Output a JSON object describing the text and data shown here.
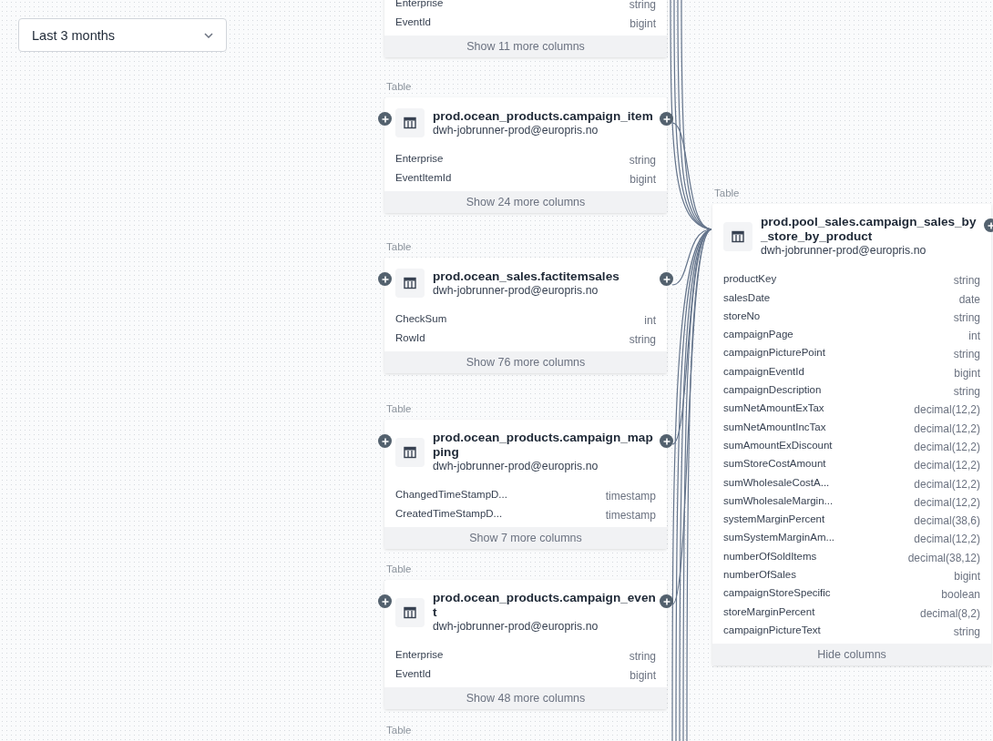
{
  "date_filter": {
    "value": "Last 3 months"
  },
  "upstream_nodes": [
    {
      "columns": [
        {
          "name": "Enterprise",
          "type": "string"
        },
        {
          "name": "EventId",
          "type": "bigint"
        }
      ],
      "toggle": "Show 11 more columns"
    },
    {
      "type_label": "Table",
      "title": "prod.ocean_products.campaign_item",
      "owner": "dwh-jobrunner-prod@europris.no",
      "upstream_button": true,
      "downstream_button": true,
      "columns": [
        {
          "name": "Enterprise",
          "type": "string"
        },
        {
          "name": "EventItemId",
          "type": "bigint"
        }
      ],
      "toggle": "Show 24 more columns"
    },
    {
      "type_label": "Table",
      "title": "prod.ocean_sales.factitemsales",
      "owner": "dwh-jobrunner-prod@europris.no",
      "upstream_button": true,
      "downstream_button": true,
      "columns": [
        {
          "name": "CheckSum",
          "type": "int"
        },
        {
          "name": "RowId",
          "type": "string"
        }
      ],
      "toggle": "Show 76 more columns"
    },
    {
      "type_label": "Table",
      "title": "prod.ocean_products.campaign_mapping",
      "owner": "dwh-jobrunner-prod@europris.no",
      "upstream_button": true,
      "downstream_button": true,
      "columns": [
        {
          "name": "ChangedTimeStampD...",
          "type": "timestamp"
        },
        {
          "name": "CreatedTimeStampD...",
          "type": "timestamp"
        }
      ],
      "toggle": "Show 7 more columns"
    },
    {
      "type_label": "Table",
      "title": "prod.ocean_products.campaign_event",
      "owner": "dwh-jobrunner-prod@europris.no",
      "upstream_button": true,
      "downstream_button": true,
      "columns": [
        {
          "name": "Enterprise",
          "type": "string"
        },
        {
          "name": "EventId",
          "type": "bigint"
        }
      ],
      "toggle": "Show 48 more columns"
    },
    {
      "type_label": "Table"
    }
  ],
  "target_node": {
    "type_label": "Table",
    "title": "prod.pool_sales.campaign_sales_by_store_by_product",
    "owner": "dwh-jobrunner-prod@europris.no",
    "upstream_button": false,
    "downstream_button": true,
    "columns": [
      {
        "name": "productKey",
        "type": "string"
      },
      {
        "name": "salesDate",
        "type": "date"
      },
      {
        "name": "storeNo",
        "type": "string"
      },
      {
        "name": "campaignPage",
        "type": "int"
      },
      {
        "name": "campaignPicturePoint",
        "type": "string"
      },
      {
        "name": "campaignEventId",
        "type": "bigint"
      },
      {
        "name": "campaignDescription",
        "type": "string"
      },
      {
        "name": "sumNetAmountExTax",
        "type": "decimal(12,2)"
      },
      {
        "name": "sumNetAmountIncTax",
        "type": "decimal(12,2)"
      },
      {
        "name": "sumAmountExDiscount",
        "type": "decimal(12,2)"
      },
      {
        "name": "sumStoreCostAmount",
        "type": "decimal(12,2)"
      },
      {
        "name": "sumWholesaleCostA...",
        "type": "decimal(12,2)"
      },
      {
        "name": "sumWholesaleMargin...",
        "type": "decimal(12,2)"
      },
      {
        "name": "systemMarginPercent",
        "type": "decimal(38,6)"
      },
      {
        "name": "sumSystemMarginAm...",
        "type": "decimal(12,2)"
      },
      {
        "name": "numberOfSoldItems",
        "type": "decimal(38,12)"
      },
      {
        "name": "numberOfSales",
        "type": "bigint"
      },
      {
        "name": "campaignStoreSpecific",
        "type": "boolean"
      },
      {
        "name": "storeMarginPercent",
        "type": "decimal(8,2)"
      },
      {
        "name": "campaignPictureText",
        "type": "string"
      }
    ],
    "toggle": "Hide columns"
  }
}
